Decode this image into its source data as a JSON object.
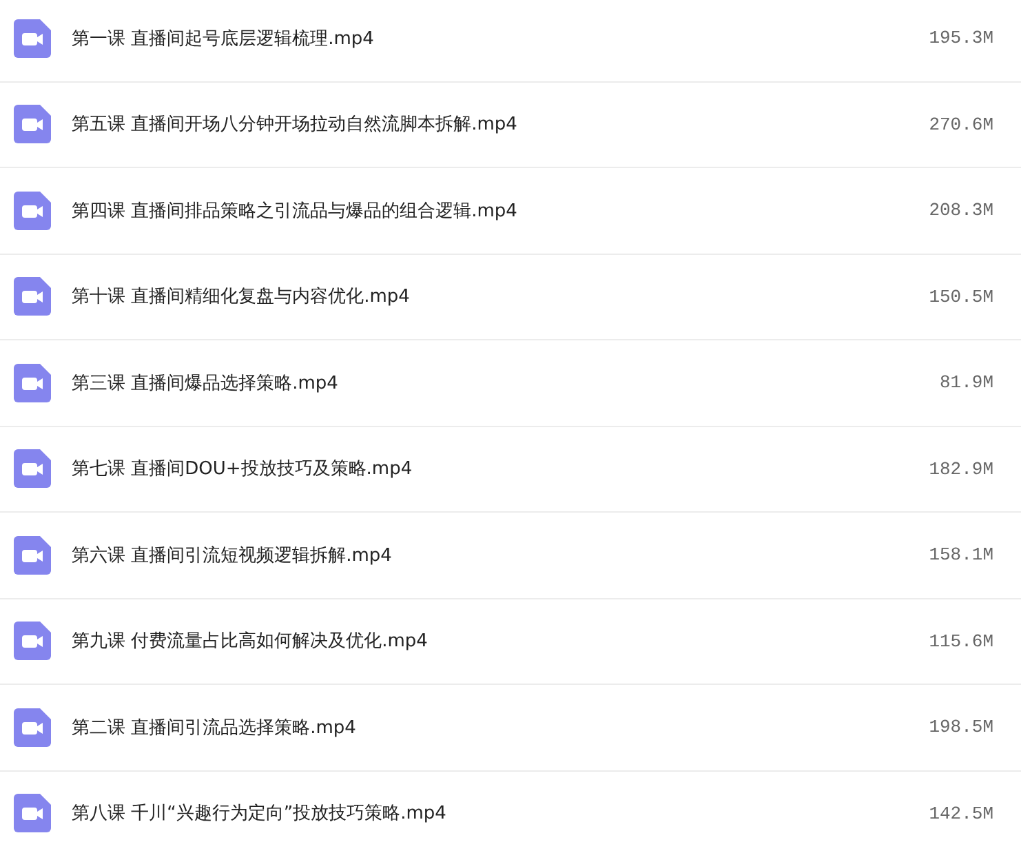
{
  "files": [
    {
      "name": "第一课 直播间起号底层逻辑梳理.mp4",
      "size": "195.3M"
    },
    {
      "name": "第五课 直播间开场八分钟开场拉动自然流脚本拆解.mp4",
      "size": "270.6M"
    },
    {
      "name": "第四课 直播间排品策略之引流品与爆品的组合逻辑.mp4",
      "size": "208.3M"
    },
    {
      "name": "第十课 直播间精细化复盘与内容优化.mp4",
      "size": "150.5M"
    },
    {
      "name": "第三课 直播间爆品选择策略.mp4",
      "size": "81.9M"
    },
    {
      "name": "第七课 直播间DOU+投放技巧及策略.mp4",
      "size": "182.9M"
    },
    {
      "name": "第六课 直播间引流短视频逻辑拆解.mp4",
      "size": "158.1M"
    },
    {
      "name": "第九课 付费流量占比高如何解决及优化.mp4",
      "size": "115.6M"
    },
    {
      "name": "第二课 直播间引流品选择策略.mp4",
      "size": "198.5M"
    },
    {
      "name": "第八课 千川“兴趣行为定向”投放技巧策略.mp4",
      "size": "142.5M"
    }
  ]
}
